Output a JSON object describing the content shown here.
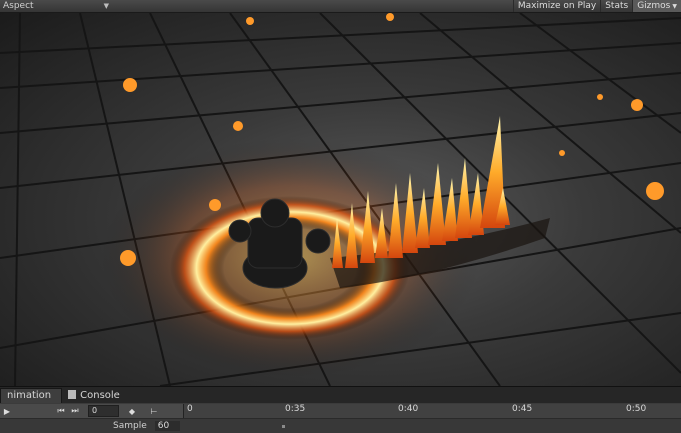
{
  "toolbar": {
    "aspect_label": "Aspect",
    "maximize_label": "Maximize on Play",
    "stats_label": "Stats",
    "gizmos_label": "Gizmos"
  },
  "animation_panel": {
    "tabs": [
      {
        "label": "nimation",
        "active": true
      },
      {
        "label": "Console",
        "active": false
      }
    ],
    "frame_value": "0",
    "timeline_ticks": [
      "0",
      "0:35",
      "0:40",
      "0:45",
      "0:50"
    ],
    "sample_label": "Sample",
    "sample_value": "60"
  },
  "colors": {
    "fire_core": "#fff3a0",
    "fire_mid": "#ff9a1f",
    "fire_outer": "#c4410c",
    "floor": "#3f3f3f"
  }
}
